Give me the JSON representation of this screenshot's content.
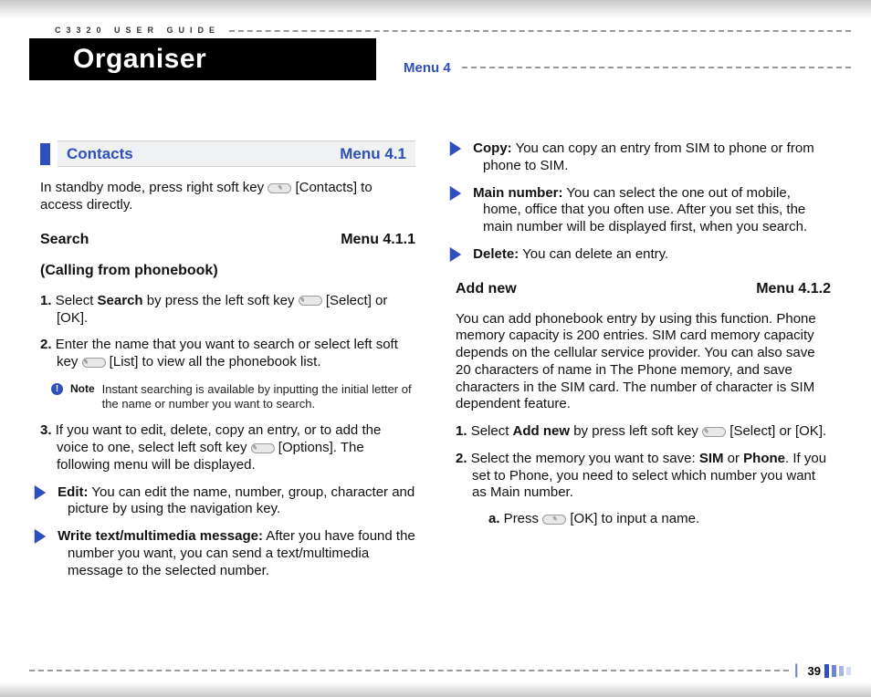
{
  "header": {
    "product_label": "C3320 USER GUIDE",
    "page_title": "Organiser",
    "menu_label": "Menu 4"
  },
  "section": {
    "name": "Contacts",
    "menu": "Menu 4.1",
    "intro_pre": "In standby mode, press right soft key ",
    "intro_post": " [Contacts] to access directly."
  },
  "search": {
    "title": "Search",
    "menu": "Menu 4.1.1",
    "subtitle": "(Calling from phonebook)",
    "steps": [
      {
        "num": "1.",
        "pre": "Select ",
        "bold": "Search",
        "post": " by press the left soft key ",
        "tail": " [Select] or [OK]."
      },
      {
        "num": "2.",
        "text_pre": "Enter the name that you want to search or select left soft key ",
        "text_post": " [List] to view all the phonebook list."
      },
      {
        "num": "3.",
        "text_pre": "If you want to edit, delete, copy an entry, or to add the voice to one, select left soft key ",
        "text_post": " [Options]. The following menu will be displayed."
      }
    ],
    "note_label": "Note",
    "note_text": "Instant searching is available by inputting the initial letter of the name or number you want to search.",
    "options": [
      {
        "label": "Edit:",
        "text": " You can edit the name, number, group, character and picture by using the navigation key."
      },
      {
        "label": "Write text/multimedia message:",
        "text": " After you have found the number you want, you can send a text/multimedia message to the selected number."
      },
      {
        "label": "Copy:",
        "text": " You can copy an entry from SIM to phone or from phone to SIM."
      },
      {
        "label": "Main number:",
        "text": " You can select the one out of mobile, home, office that you often use. After you set this, the main number will be displayed first, when you search."
      },
      {
        "label": "Delete:",
        "text": " You can delete an entry."
      }
    ]
  },
  "addnew": {
    "title": "Add new",
    "menu": "Menu 4.1.2",
    "intro": "You can add phonebook entry by using this function. Phone memory capacity is 200 entries. SIM card memory capacity depends on the cellular service provider. You can also save 20 characters of name in The Phone memory, and save characters in the SIM card. The number of character is SIM dependent feature.",
    "steps": [
      {
        "num": "1.",
        "pre": "Select ",
        "bold": "Add new",
        "post": " by press left soft key ",
        "tail": " [Select] or [OK]."
      },
      {
        "num": "2.",
        "pre": "Select the memory you want to save: ",
        "b1": "SIM",
        "mid": " or ",
        "b2": "Phone",
        "post": ". If you set to Phone, you need to select which number you want as Main number."
      }
    ],
    "substep": {
      "label": "a.",
      "pre": " Press ",
      "post": " [OK] to input a name."
    }
  },
  "footer": {
    "page_number": "39"
  }
}
